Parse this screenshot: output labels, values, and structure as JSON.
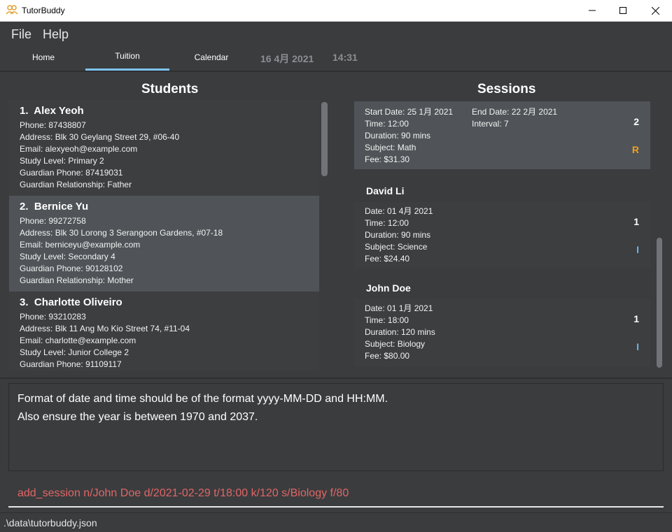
{
  "window": {
    "title": "TutorBuddy",
    "controls": {
      "minimize": "minimize-icon",
      "maximize": "maximize-icon",
      "close": "close-icon"
    }
  },
  "menu": {
    "file": "File",
    "help": "Help"
  },
  "tabs": [
    {
      "label": "Home",
      "active": false
    },
    {
      "label": "Tuition",
      "active": true
    },
    {
      "label": "Calendar",
      "active": false
    }
  ],
  "clock": {
    "date": "16 4月 2021",
    "time": "14:31"
  },
  "students": {
    "title": "Students",
    "items": [
      {
        "index": "1.",
        "name": "Alex Yeoh",
        "phone": "Phone: 87438807",
        "address": "Address: Blk 30 Geylang Street 29, #06-40",
        "email": "Email: alexyeoh@example.com",
        "study_level": "Study Level: Primary 2",
        "guardian_phone": "Guardian Phone: 87419031",
        "guardian_relationship": "Guardian Relationship: Father"
      },
      {
        "index": "2.",
        "name": "Bernice Yu",
        "phone": "Phone: 99272758",
        "address": "Address: Blk 30 Lorong 3 Serangoon Gardens, #07-18",
        "email": "Email: berniceyu@example.com",
        "study_level": "Study Level: Secondary 4",
        "guardian_phone": "Guardian Phone: 90128102",
        "guardian_relationship": "Guardian Relationship: Mother"
      },
      {
        "index": "3.",
        "name": "Charlotte Oliveiro",
        "phone": "Phone: 93210283",
        "address": "Address: Blk 11 Ang Mo Kio Street 74, #11-04",
        "email": "Email: charlotte@example.com",
        "study_level": "Study Level: Junior College 2",
        "guardian_phone": "Guardian Phone: 91109117"
      }
    ]
  },
  "sessions": {
    "title": "Sessions",
    "recurring": {
      "start_date": "Start Date: 25 1月 2021",
      "end_date": "End Date: 22 2月 2021",
      "time": "Time: 12:00",
      "interval": "Interval: 7",
      "duration": "Duration: 90 mins",
      "subject": "Subject: Math",
      "fee": "Fee: $31.30",
      "count": "2",
      "tag": "R",
      "tag_color": "#f0a020"
    },
    "groups": [
      {
        "owner": "David Li",
        "date": "Date: 01 4月 2021",
        "time": "Time: 12:00",
        "duration": "Duration: 90 mins",
        "subject": "Subject: Science",
        "fee": "Fee: $24.40",
        "count": "1",
        "tag": "I",
        "tag_color": "#6fb3e0"
      },
      {
        "owner": "John Doe",
        "date": "Date: 01 1月 2021",
        "time": "Time: 18:00",
        "duration": "Duration: 120 mins",
        "subject": "Subject: Biology",
        "fee": "Fee: $80.00",
        "count": "1",
        "tag": "I",
        "tag_color": "#6fb3e0"
      }
    ]
  },
  "result": {
    "line1": "Format of date and time should be of the format yyyy-MM-DD and HH:MM.",
    "line2": "Also ensure the year is between 1970 and 2037."
  },
  "command": {
    "value": "add_session n/John Doe d/2021-02-29 t/18:00 k/120 s/Biology f/80",
    "color": "#e06666"
  },
  "status": {
    "path": ".\\data\\tutorbuddy.json"
  }
}
